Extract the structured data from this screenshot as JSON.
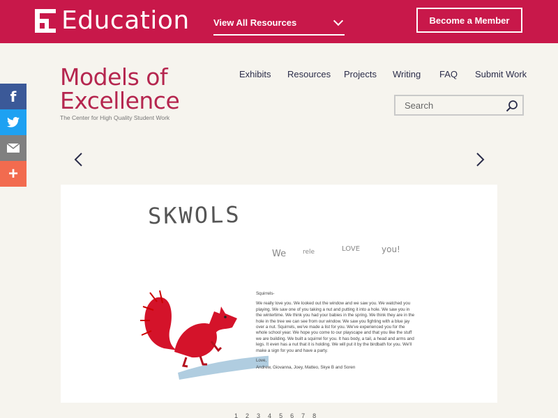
{
  "header": {
    "brand_name": "Education",
    "view_all_label": "View All Resources",
    "member_label": "Become a Member",
    "background_color": "#c8184a"
  },
  "social": {
    "facebook_label": "f",
    "plus_label": "+"
  },
  "logo": {
    "line1": "Models of",
    "line2": "Excellence",
    "tagline": "The Center for High Quality Student Work"
  },
  "nav": {
    "items": [
      "Exhibits",
      "Resources",
      "Projects",
      "Writing",
      "FAQ",
      "Submit Work"
    ]
  },
  "search": {
    "placeholder": "Search"
  },
  "artwork": {
    "title": "SKWOLS",
    "love_words": [
      "We",
      "rele",
      "LOVE",
      "you!"
    ],
    "letter_greeting": "Squirrels-",
    "letter_body": "We really love you. We looked out the window and we saw you. We watched you playing. We saw one of you taking a nut and putting it into a hole. We saw you in the wintertime. We think you had your babies in the spring. We think they are in the hole in the tree we can see from our window. We saw you fighting with a blue jay over a nut. Squirrels, we've made a list for you. We've experienced you for the whole school year. We hope you come to our playscape and that you like the stuff we are building. We built a squirrel for you. It has body, a tail, a head and arms and legs. It even has a nut that it is holding. We will put it by the birdbath for you. We'll make a sign for you and have a party.",
    "letter_closing": "Love,",
    "letter_signers": "Andrew, Giovanna, Joey, Matteo, Skye B and Soren"
  },
  "pager": {
    "pages": [
      "1",
      "2",
      "3",
      "4",
      "5",
      "6",
      "7",
      "8"
    ]
  }
}
